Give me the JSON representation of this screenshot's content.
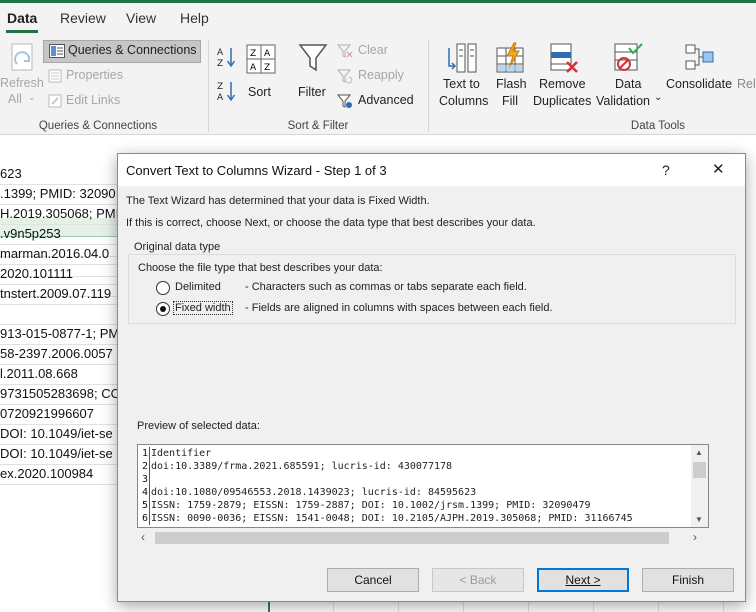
{
  "ribbon": {
    "tabs": [
      "Data",
      "Review",
      "View",
      "Help"
    ],
    "active_tab": "Data",
    "refresh_all": "Refresh\nAll",
    "refresh_label_1": "Refresh",
    "refresh_label_2": "All",
    "queries_connections": "Queries & Connections",
    "properties": "Properties",
    "edit_links": "Edit Links",
    "group_queries": "Queries & Connections",
    "sort": "Sort",
    "filter": "Filter",
    "clear": "Clear",
    "reapply": "Reapply",
    "advanced": "Advanced",
    "group_sort": "Sort & Filter",
    "text_to_columns_1": "Text to",
    "text_to_columns_2": "Columns",
    "flash_fill_1": "Flash",
    "flash_fill_2": "Fill",
    "remove_dup_1": "Remove",
    "remove_dup_2": "Duplicates",
    "data_validation_1": "Data",
    "data_validation_2": "Validation",
    "consolidate": "Consolidate",
    "relationships_partial": "Rela",
    "group_data_tools": "Data Tools"
  },
  "sheet": {
    "cells": [
      "623",
      ".1399; PMID: 32090",
      "H.2019.305068; PMI",
      ".v9n5p253",
      "marman.2016.04.0",
      "2020.101111",
      "tnstert.2009.07.119",
      "",
      "913-015-0877-1; PM",
      "58-2397.2006.0057",
      "l.2011.08.668",
      "9731505283698; CO",
      "0720921996607",
      "DOI: 10.1049/iet-se",
      "DOI: 10.1049/iet-se",
      "ex.2020.100984"
    ]
  },
  "dialog": {
    "title": "Convert Text to Columns Wizard - Step 1 of 3",
    "help": "?",
    "close": "✕",
    "intro1": "The Text Wizard has determined that your data is Fixed Width.",
    "intro2": "If this is correct, choose Next, or choose the data type that best describes your data.",
    "group_title": "Original data type",
    "choose_label": "Choose the file type that best describes your data:",
    "option_delimited": "Delimited",
    "option_delimited_desc": "- Characters such as commas or tabs separate each field.",
    "option_fixed": "Fixed width",
    "option_fixed_desc": "- Fields are aligned in columns with spaces between each field.",
    "selected_option": "Fixed width",
    "preview_label": "Preview of selected data:",
    "preview_lines": [
      {
        "n": "1",
        "text": "Identifier"
      },
      {
        "n": "2",
        "text": "doi:10.3389/frma.2021.685591;  lucris-id: 430077178"
      },
      {
        "n": "3",
        "text": ""
      },
      {
        "n": "4",
        "text": "doi:10.1080/09546553.2018.1439023;  lucris-id: 84595623"
      },
      {
        "n": "5",
        "text": "ISSN: 1759-2879; EISSN: 1759-2887; DOI: 10.1002/jrsm.1399; PMID: 32090479"
      },
      {
        "n": "6",
        "text": "ISSN: 0090-0036; EISSN: 1541-0048; DOI: 10.2105/AJPH.2019.305068; PMID: 31166745"
      }
    ],
    "buttons": {
      "cancel": "Cancel",
      "back": "< Back",
      "next": "Next >",
      "finish": "Finish"
    }
  },
  "colors": {
    "excel_green": "#217346",
    "dialog_bg": "#f0f0f0",
    "focus_blue": "#0078d7"
  }
}
